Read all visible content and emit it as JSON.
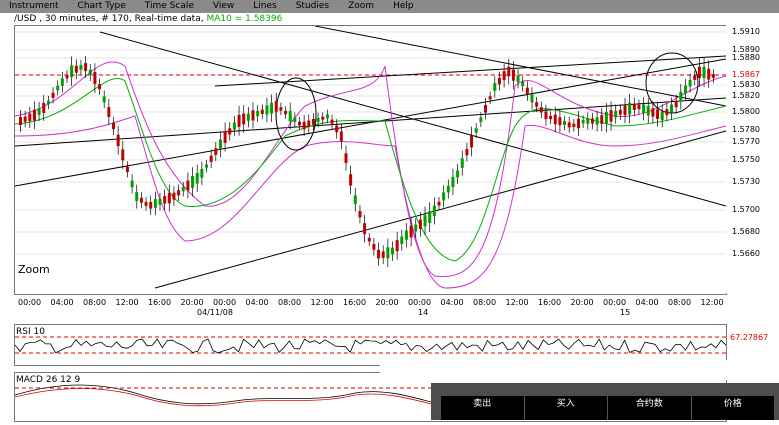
{
  "menu": [
    "Instrument",
    "Chart Type",
    "Time Scale",
    "View",
    "Lines",
    "Studies",
    "Zoom",
    "Help"
  ],
  "title": {
    "prefix": "/USD , 30 minutes, # 170, Real-time data",
    "ma": "MA10 = 1.58396"
  },
  "price_scale": [
    "1.5910",
    "1.5890",
    "1.5880",
    "1.5867",
    "1.5830",
    "1.5820",
    "1.5800",
    "1.5780",
    "1.5770",
    "1.5750",
    "1.5730",
    "1.5700",
    "1.5680",
    "1.5660"
  ],
  "time_labels": [
    "00:00",
    "04:00",
    "08:00",
    "12:00",
    "16:00",
    "20:00",
    "00:00",
    "04:00",
    "08:00",
    "12:00",
    "16:00",
    "20:00",
    "00:00",
    "04:00",
    "08:00",
    "12:00",
    "16:00",
    "20:00",
    "00:00",
    "04:00",
    "08:00",
    "12:00"
  ],
  "date_labels": [
    "04/11/08",
    "14",
    "15"
  ],
  "zoom_label": "Zoom",
  "rsi": {
    "label": "RSI 10",
    "value": "67.27867"
  },
  "macd": {
    "label": "MACD 26 12 9"
  },
  "popup": {
    "columns": [
      "卖出",
      "买入",
      "合约数",
      "价格"
    ]
  },
  "colors": {
    "up": "#00a000",
    "down": "#c00000",
    "bollinger": "#cc33cc",
    "ma": "#00b000",
    "resistance": "#dd0000"
  }
}
